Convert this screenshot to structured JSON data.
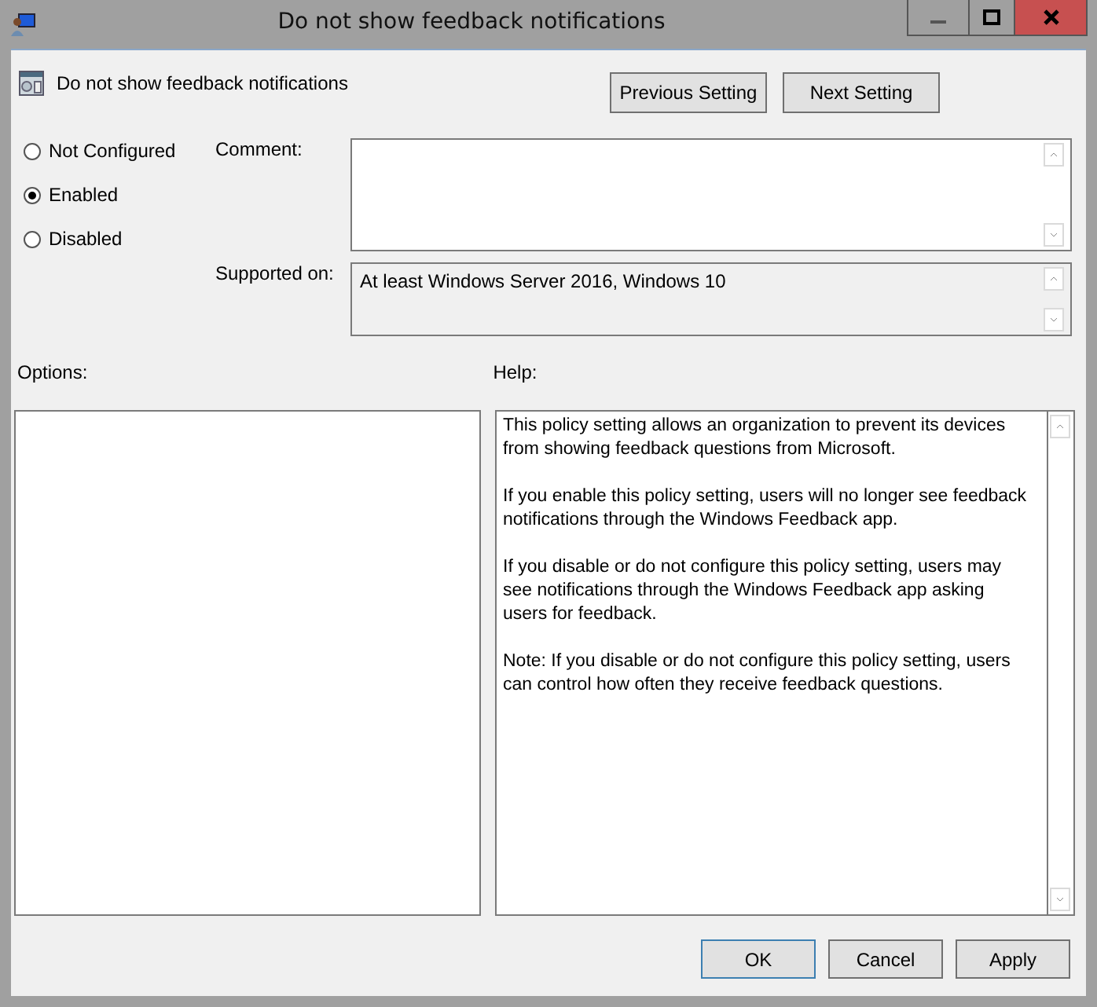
{
  "window": {
    "title": "Do not show feedback notifications"
  },
  "policy": {
    "title": "Do not show feedback notifications"
  },
  "nav_buttons": [
    "Previous Setting",
    "Next Setting"
  ],
  "state_options": [
    {
      "label": "Not Configured",
      "selected": false
    },
    {
      "label": "Enabled",
      "selected": true
    },
    {
      "label": "Disabled",
      "selected": false
    }
  ],
  "comment": {
    "label": "Comment:"
  },
  "supported_on": {
    "label": "Supported on:",
    "value": "At least Windows Server 2016, Windows 10"
  },
  "options": {
    "label": "Options:"
  },
  "help": {
    "label": "Help:",
    "paragraphs": [
      "This policy setting allows an organization to prevent its devices from showing feedback questions from Microsoft.",
      "If you enable this policy setting, users will no longer see feedback notifications through the Windows Feedback app.",
      "If you disable or do not configure this policy setting, users may see notifications through the Windows Feedback app asking users for feedback.",
      "Note: If you disable or do not configure this policy setting, users can control how often they receive feedback questions."
    ]
  },
  "buttons": [
    {
      "label": "OK",
      "default": true
    },
    {
      "label": "Cancel",
      "default": false
    },
    {
      "label": "Apply",
      "default": false
    }
  ]
}
